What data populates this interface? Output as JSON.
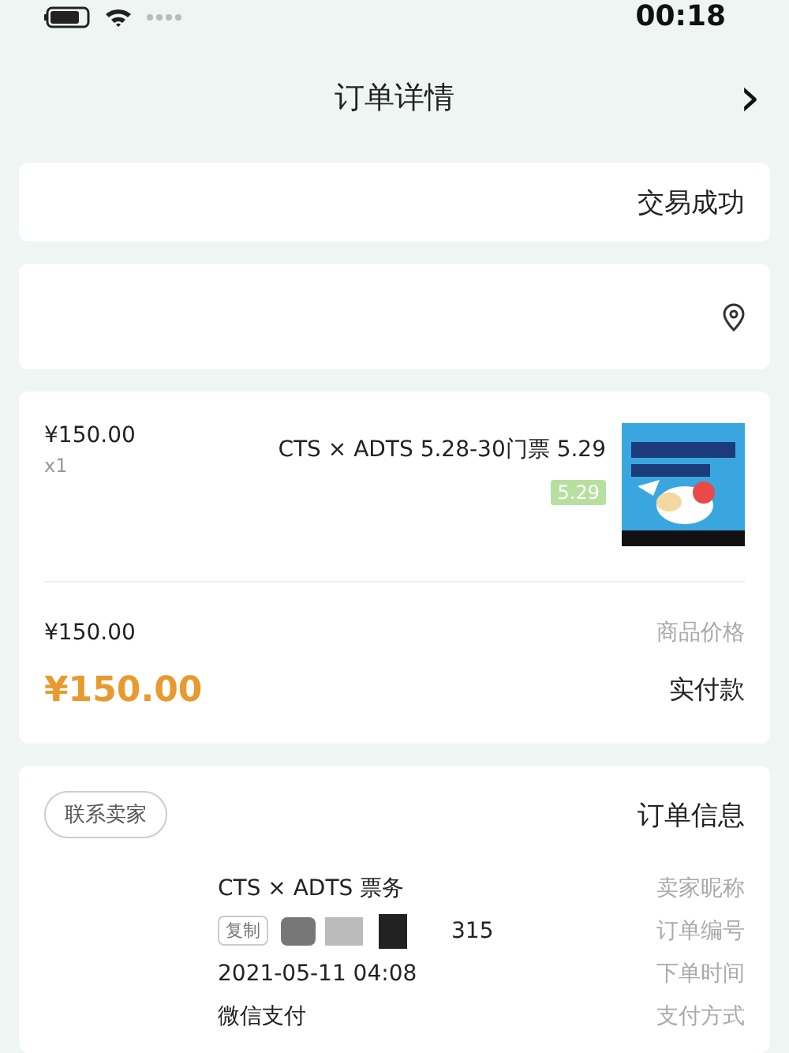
{
  "status_bar": {
    "time": "00:18"
  },
  "header": {
    "title": "订单详情",
    "back_icon": "›"
  },
  "status_card": {
    "status": "交易成功"
  },
  "address_card": {
    "kind": "location"
  },
  "product": {
    "name": "CTS × ADTS 5.28-30门票 5.29",
    "tag": "5.29",
    "price": "¥150.00",
    "quantity": "x1"
  },
  "price_rows": [
    {
      "kind": "normal",
      "label": "商品价格",
      "value": "¥150.00"
    },
    {
      "kind": "total",
      "label": "实付款",
      "value": "¥150.00"
    }
  ],
  "order_info": {
    "title": "订单信息",
    "contact_button": "联系卖家",
    "rows": [
      {
        "kind": "text",
        "label": "卖家昵称",
        "value": "CTS × ADTS 票务"
      },
      {
        "kind": "order_no",
        "label": "订单编号",
        "value": "315",
        "copy": "复制"
      },
      {
        "kind": "text",
        "label": "下单时间",
        "value": "2021-05-11 04:08"
      },
      {
        "kind": "text",
        "label": "支付方式",
        "value": "微信支付"
      }
    ]
  }
}
